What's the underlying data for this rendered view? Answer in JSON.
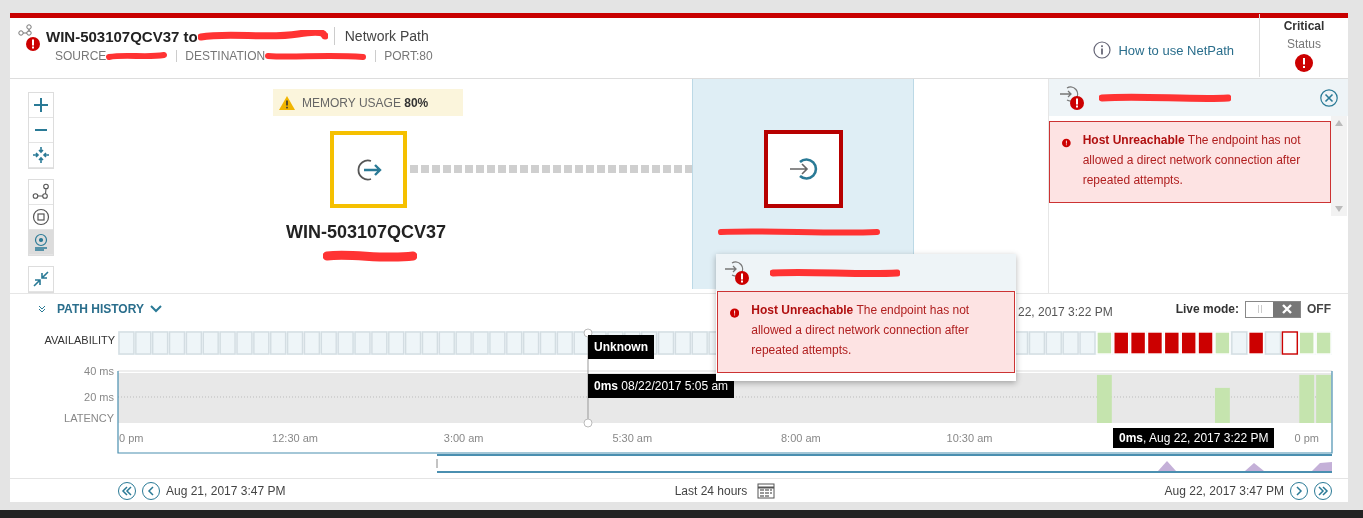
{
  "header": {
    "title": "WIN-503107QCV37 to",
    "subtitle": "Network Path",
    "source_label": "SOURCE",
    "destination_label": "DESTINATION",
    "port": "PORT:80",
    "help_link": "How to use NetPath",
    "status": {
      "value": "Critical",
      "label": "Status"
    }
  },
  "toolbar": {
    "groups": [
      {
        "buttons": [
          {
            "kind": "zoom-in",
            "selected": false
          },
          {
            "kind": "zoom-out",
            "selected": false
          },
          {
            "kind": "fit",
            "selected": false
          }
        ]
      },
      {
        "buttons": [
          {
            "kind": "path",
            "selected": false
          },
          {
            "kind": "node",
            "selected": false
          },
          {
            "kind": "endpoint",
            "selected": true
          }
        ]
      },
      {
        "buttons": [
          {
            "kind": "collapse",
            "selected": false
          }
        ]
      }
    ]
  },
  "map": {
    "warning": {
      "label": "MEMORY USAGE",
      "value": "80%"
    },
    "nodes": [
      {
        "kind": "source",
        "name": "WIN-503107QCV37",
        "color": "#f5c000",
        "selected": false
      },
      {
        "kind": "destination",
        "color": "#b70000",
        "selected": true
      }
    ]
  },
  "detail_panel": {
    "alert": {
      "title": "Host Unreachable",
      "message": "The endpoint has not allowed a direct network connection after repeated attempts."
    }
  },
  "popup": {
    "alert": {
      "title": "Host Unreachable",
      "message": "The endpoint has not allowed a direct network connection after repeated attempts."
    }
  },
  "path_history": {
    "title": "PATH HISTORY",
    "partial_time": "22, 2017 3:22 PM",
    "live_mode": {
      "label": "Live mode:",
      "on": false,
      "state_text": "OFF"
    },
    "availability": {
      "label": "AVAILABILITY",
      "cells": [
        {
          "kind": "unknown"
        },
        {
          "kind": "unknown"
        },
        {
          "kind": "unknown"
        },
        {
          "kind": "unknown"
        },
        {
          "kind": "unknown"
        },
        {
          "kind": "unknown"
        },
        {
          "kind": "unknown"
        },
        {
          "kind": "unknown"
        },
        {
          "kind": "unknown"
        },
        {
          "kind": "unknown"
        },
        {
          "kind": "unknown"
        },
        {
          "kind": "unknown"
        },
        {
          "kind": "unknown"
        },
        {
          "kind": "unknown"
        },
        {
          "kind": "unknown"
        },
        {
          "kind": "unknown"
        },
        {
          "kind": "unknown"
        },
        {
          "kind": "unknown"
        },
        {
          "kind": "unknown"
        },
        {
          "kind": "unknown"
        },
        {
          "kind": "unknown"
        },
        {
          "kind": "unknown"
        },
        {
          "kind": "unknown"
        },
        {
          "kind": "unknown"
        },
        {
          "kind": "unknown"
        },
        {
          "kind": "unknown"
        },
        {
          "kind": "unknown"
        },
        {
          "kind": "unknown"
        },
        {
          "kind": "unknown"
        },
        {
          "kind": "unknown"
        },
        {
          "kind": "unknown"
        },
        {
          "kind": "unknown"
        },
        {
          "kind": "unknown"
        },
        {
          "kind": "unknown"
        },
        {
          "kind": "unknown"
        },
        {
          "kind": "unknown"
        }
      ],
      "cells_after_popup": [
        {
          "kind": "unknown"
        },
        {
          "kind": "unknown"
        },
        {
          "kind": "unknown"
        },
        {
          "kind": "unknown"
        },
        {
          "kind": "unknown"
        },
        {
          "kind": "up"
        },
        {
          "kind": "down"
        },
        {
          "kind": "down"
        },
        {
          "kind": "down"
        },
        {
          "kind": "down"
        },
        {
          "kind": "down"
        },
        {
          "kind": "down"
        },
        {
          "kind": "up"
        },
        {
          "kind": "unknown"
        },
        {
          "kind": "down"
        },
        {
          "kind": "unknown"
        },
        {
          "kind": "partial"
        },
        {
          "kind": "up"
        },
        {
          "kind": "up"
        }
      ]
    },
    "latency": {
      "chart_data": {
        "type": "bar",
        "ylabel": "LATENCY",
        "ylim": [
          0,
          40
        ],
        "yticks": [
          {
            "value": 20,
            "label": "20 ms"
          },
          {
            "value": 40,
            "label": "40 ms"
          }
        ],
        "categories": [
          "0 pm",
          null,
          null,
          null,
          null,
          null,
          null,
          null,
          null,
          null,
          "12:30 am",
          null,
          null,
          null,
          null,
          null,
          null,
          null,
          null,
          null,
          "3:00 am",
          null,
          null,
          null,
          null,
          null,
          null,
          null,
          null,
          null,
          "5:30 am",
          null,
          null,
          null,
          null,
          null,
          null,
          null,
          null,
          null,
          "8:00 am",
          null,
          null,
          null,
          null,
          null,
          null,
          null,
          null,
          null,
          "10:30 am",
          null,
          null,
          null,
          null,
          null,
          null,
          null,
          null,
          null,
          null,
          null,
          null,
          null,
          null,
          null,
          null,
          null,
          null,
          null,
          "0 pm",
          null
        ],
        "values": [
          null,
          null,
          null,
          null,
          null,
          null,
          null,
          null,
          null,
          null,
          null,
          null,
          null,
          null,
          null,
          null,
          null,
          null,
          null,
          null,
          null,
          null,
          null,
          null,
          null,
          null,
          null,
          null,
          null,
          null,
          null,
          null,
          null,
          null,
          null,
          null,
          null,
          null,
          null,
          null,
          null,
          null,
          null,
          null,
          null,
          null,
          null,
          null,
          null,
          null,
          null,
          null,
          null,
          null,
          null,
          null,
          null,
          null,
          37,
          null,
          null,
          null,
          null,
          null,
          null,
          27,
          null,
          null,
          null,
          null,
          37,
          37
        ]
      }
    },
    "cursor_tooltips": [
      {
        "kind": "status",
        "text": "Unknown"
      },
      {
        "kind": "latency",
        "text": "**0ms** 08/22/2017 5:05 am"
      }
    ],
    "point_tooltip": "**0ms**, Aug 22, 2017 3:22 PM"
  },
  "footer": {
    "start": "Aug 21, 2017 3:47 PM",
    "range": "Last 24 hours",
    "end": "Aug 22, 2017 3:47 PM"
  }
}
